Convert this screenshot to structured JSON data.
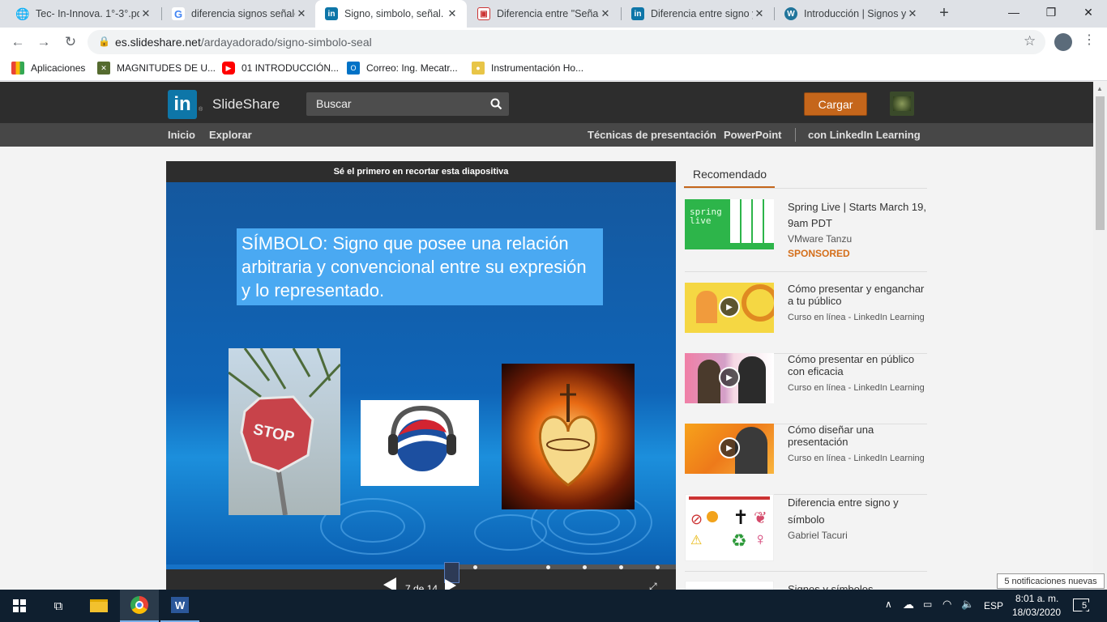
{
  "browser": {
    "tabs": [
      {
        "title": "Tec- In-Innova. 1°-3°.pd",
        "favicon": "globe-icon"
      },
      {
        "title": "diferencia signos señale",
        "favicon": "google-icon"
      },
      {
        "title": "Signo, simbolo, señal.",
        "favicon": "linkedin-icon"
      },
      {
        "title": "Diferencia entre \"Señal\"",
        "favicon": "slide-icon"
      },
      {
        "title": "Diferencia entre signo y",
        "favicon": "linkedin-icon"
      },
      {
        "title": "Introducción | Signos y",
        "favicon": "wordpress-icon"
      }
    ],
    "url_host": "es.slideshare.net",
    "url_path": "/ardayadorado/signo-simbolo-seal",
    "bookmarks": [
      {
        "label": "Aplicaciones"
      },
      {
        "label": "MAGNITUDES DE U..."
      },
      {
        "label": "01 INTRODUCCIÓN..."
      },
      {
        "label": "Correo: Ing. Mecatr..."
      },
      {
        "label": "Instrumentación Ho..."
      }
    ]
  },
  "slideshare": {
    "brand": "SlideShare",
    "search_placeholder": "Buscar",
    "upload_label": "Cargar",
    "nav": {
      "home": "Inicio",
      "explore": "Explorar",
      "techniques": "Técnicas de presentación",
      "powerpoint": "PowerPoint",
      "linkedin": "con LinkedIn Learning"
    }
  },
  "viewer": {
    "clip_banner": "Sé el primero en recortar esta diapositiva",
    "slide_title": "SÍMBOLO: Signo que posee una relación arbitraria y convencional entre su expresión y lo representado.",
    "stop_sign_text": "STOP",
    "counter": "7 de 14",
    "progress_fraction": 0.5
  },
  "recommended": {
    "tab_label": "Recomendado",
    "items": [
      {
        "title": "Spring Live | Starts March 19, 9am PDT",
        "sub": "VMware Tanzu",
        "badge": "SPONSORED",
        "thumb_text": "spring live"
      },
      {
        "title": "Cómo presentar y enganchar a tu público",
        "sub": "Curso en línea - LinkedIn Learning"
      },
      {
        "title": "Cómo presentar en público con eficacia",
        "sub": "Curso en línea - LinkedIn Learning"
      },
      {
        "title": "Cómo diseñar una presentación",
        "sub": "Curso en línea - LinkedIn Learning"
      },
      {
        "title": "Diferencia entre signo y símbolo",
        "sub": "Gabriel Tacuri"
      },
      {
        "title": "Signos y símbolos",
        "sub": ""
      }
    ]
  },
  "taskbar": {
    "language": "ESP",
    "time": "8:01 a. m.",
    "date": "18/03/2020",
    "notification_count": "5",
    "notification_toast": "5 notificaciones nuevas"
  },
  "colors": {
    "slideshare_orange": "#c5661b",
    "linkedin_blue": "#0e76a8",
    "slide_blue": "#0f65b8"
  }
}
